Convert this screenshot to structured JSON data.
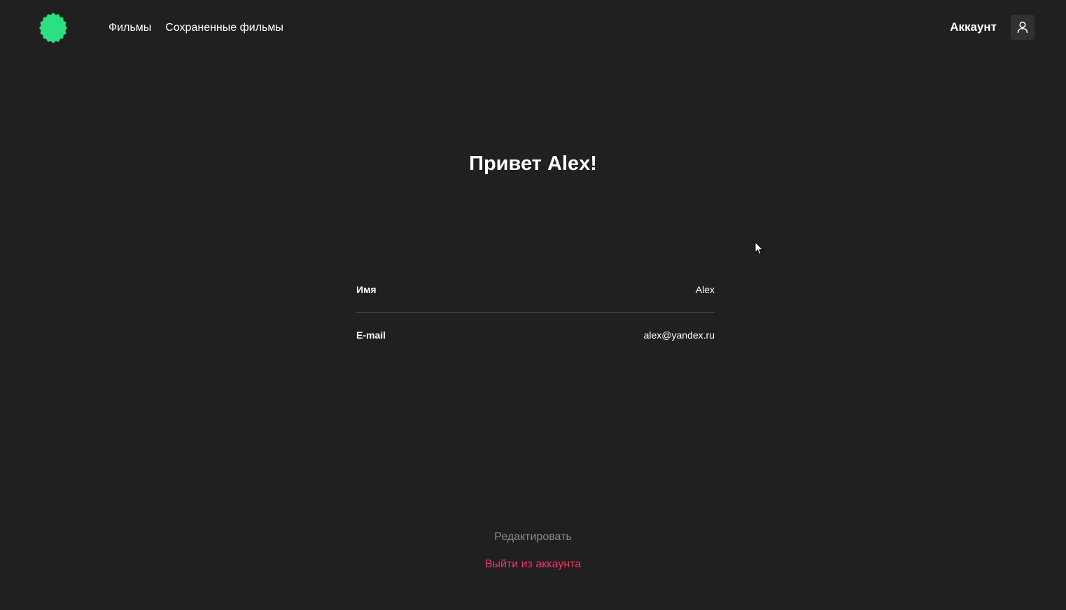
{
  "header": {
    "nav": {
      "movies": "Фильмы",
      "saved_movies": "Сохраненные фильмы"
    },
    "account_label": "Аккаунт",
    "account_icon": "user-icon",
    "logo_icon": "badge-logo",
    "logo_color": "#2be080"
  },
  "main": {
    "greeting": "Привет Alex!",
    "fields": [
      {
        "label": "Имя",
        "value": "Alex"
      },
      {
        "label": "E-mail",
        "value": "alex@yandex.ru"
      }
    ],
    "edit_label": "Редактировать",
    "logout_label": "Выйти из аккаунта"
  },
  "colors": {
    "background": "#202020",
    "accent": "#2be080",
    "danger": "#ee3465",
    "muted": "#8b8b8b"
  }
}
